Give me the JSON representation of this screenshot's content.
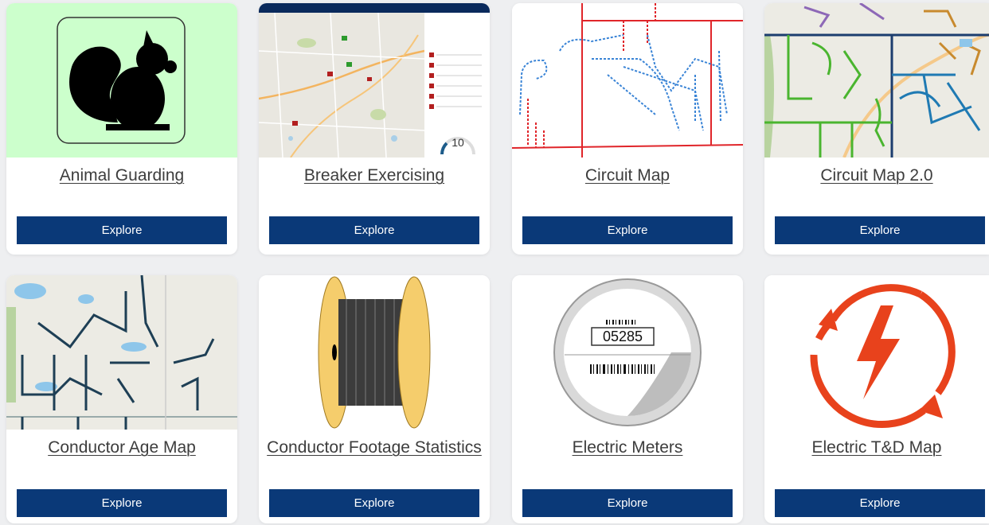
{
  "cards": [
    {
      "title": "Animal Guarding",
      "button": "Explore",
      "icon": "squirrel-icon"
    },
    {
      "title": "Breaker Exercising",
      "button": "Explore",
      "icon": "map-dashboard-thumbnail",
      "gauge_value": "10"
    },
    {
      "title": "Circuit Map",
      "button": "Explore",
      "icon": "circuit-lines-thumbnail"
    },
    {
      "title": "Circuit Map 2.0",
      "button": "Explore",
      "icon": "colored-circuit-map-thumbnail"
    },
    {
      "title": "Conductor Age Map",
      "button": "Explore",
      "icon": "conductor-age-map-thumbnail"
    },
    {
      "title": "Conductor Footage Statistics",
      "button": "Explore",
      "icon": "cable-spool-icon"
    },
    {
      "title": "Electric Meters",
      "button": "Explore",
      "icon": "electric-meter-icon",
      "meter_reading": "05285"
    },
    {
      "title": "Electric T&D Map",
      "button": "Explore",
      "icon": "lightning-cycle-icon"
    }
  ],
  "colors": {
    "button_bg": "#0a3978",
    "squirrel_bg": "#ccffcc",
    "accent_red": "#e8421c"
  }
}
